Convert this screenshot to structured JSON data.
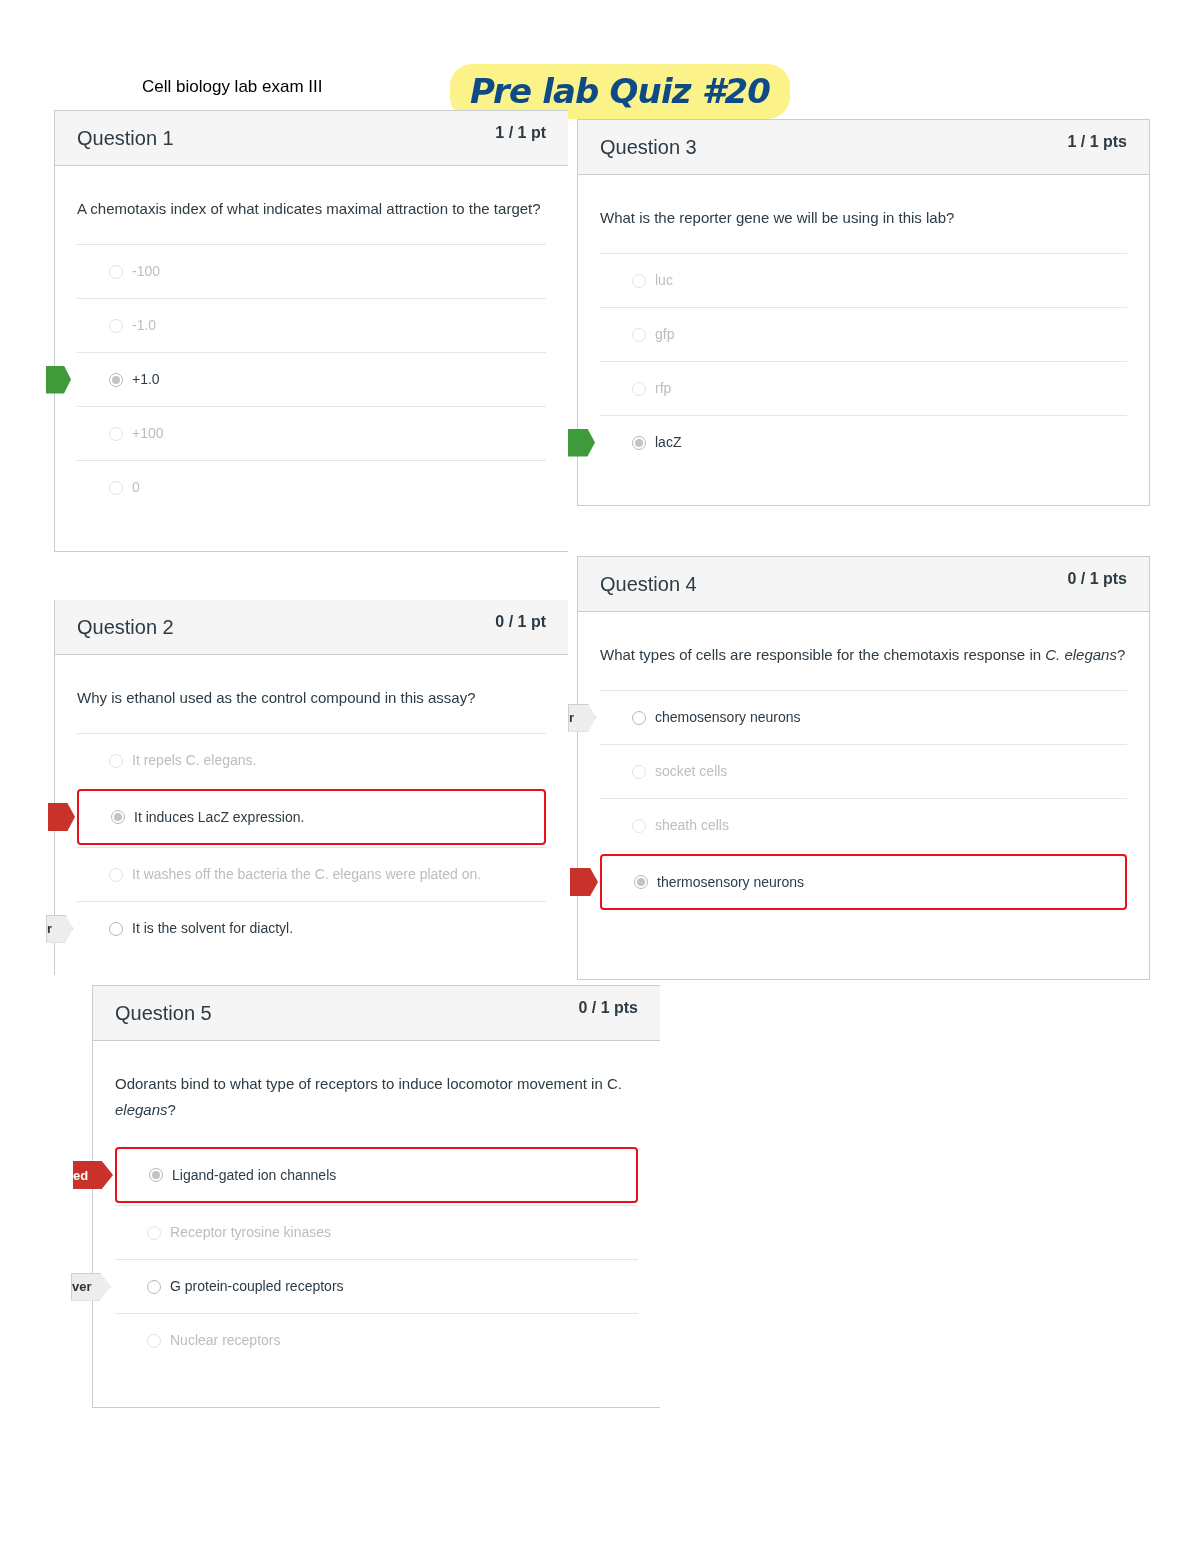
{
  "document_title": "Cell biology lab exam III",
  "handwritten_note": "Pre lab Quiz #20",
  "questions": [
    {
      "title": "Question 1",
      "points": "1 / 1 pt",
      "text": "A chemotaxis index of what indicates maximal attraction to the target?",
      "answers": [
        {
          "text": "-100",
          "selected": false,
          "dimmed": true
        },
        {
          "text": "-1.0",
          "selected": false,
          "dimmed": true
        },
        {
          "text": "+1.0",
          "selected": true,
          "dimmed": false,
          "marker": {
            "kind": "correct"
          }
        },
        {
          "text": "+100",
          "selected": false,
          "dimmed": true
        },
        {
          "text": "0",
          "selected": false,
          "dimmed": true
        }
      ]
    },
    {
      "title": "Question 2",
      "points": "0 / 1 pt",
      "text": "Why is ethanol used as the control compound in this assay?",
      "answers": [
        {
          "text": "It repels C. elegans.",
          "selected": false,
          "dimmed": true
        },
        {
          "text": "It induces LacZ expression.",
          "selected": true,
          "dimmed": false,
          "marker": {
            "kind": "wrong"
          }
        },
        {
          "text": "It washes off the bacteria the C. elegans were plated on.",
          "selected": false,
          "dimmed": true
        },
        {
          "text": "It is the solvent for diactyl.",
          "selected": false,
          "dimmed": false,
          "marker": {
            "kind": "answer",
            "label": "r"
          }
        }
      ]
    },
    {
      "title": "Question 3",
      "points": "1 / 1 pts",
      "text": "What is the reporter gene we will be using in this lab?",
      "answers": [
        {
          "text": "luc",
          "selected": false,
          "dimmed": true
        },
        {
          "text": "gfp",
          "selected": false,
          "dimmed": true
        },
        {
          "text": "rfp",
          "selected": false,
          "dimmed": true
        },
        {
          "text": "lacZ",
          "selected": true,
          "dimmed": false,
          "marker": {
            "kind": "correct"
          }
        }
      ]
    },
    {
      "title": "Question 4",
      "points": "0 / 1 pts",
      "text": "What types of cells are responsible for the chemotaxis response in *C. elegans*?",
      "answers": [
        {
          "text": "chemosensory neurons",
          "selected": false,
          "dimmed": false,
          "marker": {
            "kind": "answer",
            "label": "r"
          }
        },
        {
          "text": "socket cells",
          "selected": false,
          "dimmed": true
        },
        {
          "text": "sheath cells",
          "selected": false,
          "dimmed": true
        },
        {
          "text": "thermosensory neurons",
          "selected": true,
          "dimmed": false,
          "marker": {
            "kind": "wrong"
          }
        }
      ]
    },
    {
      "title": "Question 5",
      "points": "0 / 1 pts",
      "text": "Odorants bind to what type of receptors to induce locomotor movement in C. *elegans*?",
      "answers": [
        {
          "text": "Ligand-gated ion channels",
          "selected": true,
          "dimmed": false,
          "marker": {
            "kind": "wrong",
            "label": "ed"
          }
        },
        {
          "text": "Receptor tyrosine kinases",
          "selected": false,
          "dimmed": true
        },
        {
          "text": "G protein-coupled receptors",
          "selected": false,
          "dimmed": false,
          "marker": {
            "kind": "answer",
            "label": "ver"
          }
        },
        {
          "text": "Nuclear receptors",
          "selected": false,
          "dimmed": true
        }
      ]
    }
  ]
}
